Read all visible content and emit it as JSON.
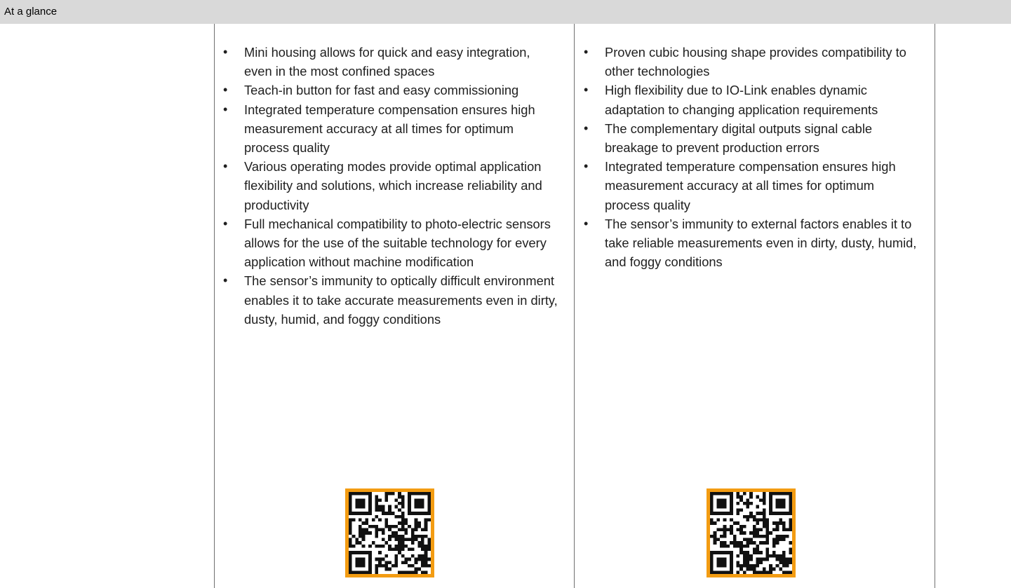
{
  "header": {
    "title": "At a glance"
  },
  "columns": {
    "left": {
      "items": [
        "Mini housing allows for quick and easy integration, even in the most confined spaces",
        "Teach-in button for fast and easy commissioning",
        "Integrated temperature compensation ensures high measurement accuracy at all times for optimum process quality",
        "Various operating modes provide optimal application flexibility and solutions, which increase reliability and productivity",
        "Full mechanical compatibility to photo-electric sensors allows for the use of the suitable technology for every application without machine modification",
        "The sensor’s immunity to optically difficult environment enables it to take accurate measurements even in dirty, dusty, humid, and foggy conditions"
      ],
      "qr_icon": "qr-code-icon"
    },
    "right": {
      "items": [
        "Proven cubic housing shape provides compatibility to other technologies",
        "High flexibility due to IO-Link enables dynamic adaptation to changing application requirements",
        "The complementary digital outputs signal cable breakage to prevent production errors",
        "Integrated temperature compensation ensures high measurement accuracy at all times for optimum process quality",
        "The sensor’s immunity to external factors enables it to take reliable measurements even in dirty, dusty, humid, and foggy conditions"
      ],
      "qr_icon": "qr-code-icon"
    }
  },
  "colors": {
    "header_bg": "#d9d9d9",
    "qr_border": "#f39c12",
    "divider": "#6f6f6f"
  }
}
